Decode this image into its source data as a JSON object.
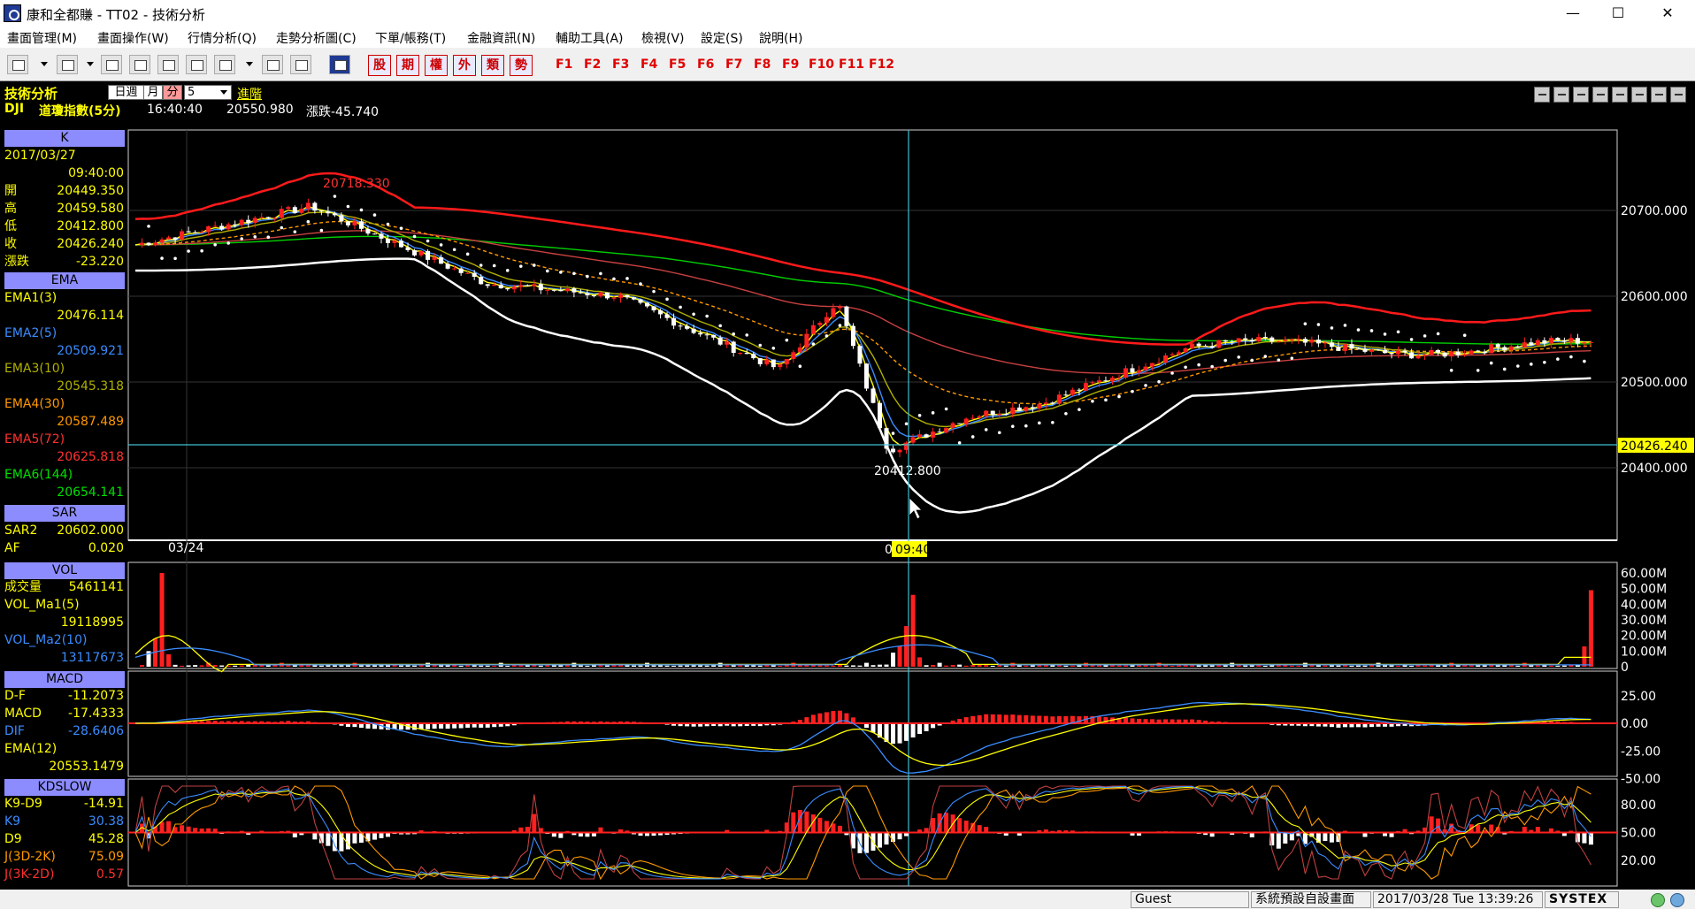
{
  "window": {
    "title": "康和全都賺 - TT02 - 技術分析",
    "minimize": "—",
    "maximize": "☐",
    "close": "✕"
  },
  "menu": [
    "畫面管理(M)",
    "畫面操作(W)",
    "行情分析(Q)",
    "走勢分析圖(C)",
    "下單/帳務(T)",
    "金融資訊(N)",
    "輔助工具(A)",
    "檢視(V)",
    "設定(S)",
    "說明(H)"
  ],
  "toolbar": {
    "quote_buttons": [
      "股",
      "期",
      "權",
      "外",
      "類",
      "勢"
    ],
    "function_keys": [
      "F1",
      "F2",
      "F3",
      "F4",
      "F5",
      "F6",
      "F7",
      "F8",
      "F9",
      "F10",
      "F11",
      "F12"
    ]
  },
  "header": {
    "title": "技術分析",
    "periods": [
      "日",
      "週",
      "月",
      "分"
    ],
    "period_value": "5",
    "advanced": "進階",
    "symbol": "DJI",
    "symbol_name": "道瓊指數(5分)",
    "time": "16:40:40",
    "price": "20550.980",
    "change": "漲跌-45.740"
  },
  "k_panel": {
    "head": "K",
    "date": "2017/03/27",
    "time": "09:40:00",
    "rows": [
      {
        "k": "開",
        "v": "20449.350"
      },
      {
        "k": "高",
        "v": "20459.580"
      },
      {
        "k": "低",
        "v": "20412.800"
      },
      {
        "k": "收",
        "v": "20426.240"
      },
      {
        "k": "漲跌",
        "v": "-23.220"
      }
    ]
  },
  "ema_panel": {
    "head": "EMA",
    "items": [
      {
        "name": "EMA1(3)",
        "value": "20476.114",
        "color": "#ffff00"
      },
      {
        "name": "EMA2(5)",
        "value": "20509.921",
        "color": "#3a8cff"
      },
      {
        "name": "EMA3(10)",
        "value": "20545.318",
        "color": "#b0b000"
      },
      {
        "name": "EMA4(30)",
        "value": "20587.489",
        "color": "#ff9900"
      },
      {
        "name": "EMA5(72)",
        "value": "20625.818",
        "color": "#ff3030"
      },
      {
        "name": "EMA6(144)",
        "value": "20654.141",
        "color": "#00e000"
      }
    ]
  },
  "sar_panel": {
    "head": "SAR",
    "rows": [
      {
        "k": "SAR2",
        "v": "20602.000"
      },
      {
        "k": "AF",
        "v": "0.020"
      }
    ]
  },
  "vol_panel": {
    "head": "VOL",
    "rows": [
      {
        "k": "成交量",
        "v": "5461141",
        "kc": "#ffff00"
      },
      {
        "k": "VOL_Ma1(5)",
        "v": "19118995",
        "kc": "#ffff00"
      },
      {
        "k": "VOL_Ma2(10)",
        "v": "13117673",
        "kc": "#3a8cff"
      }
    ]
  },
  "macd_panel": {
    "head": "MACD",
    "rows": [
      {
        "k": "D-F",
        "v": "-11.2073",
        "kc": "#ffff00"
      },
      {
        "k": "MACD",
        "v": "-17.4333",
        "kc": "#ffff00"
      },
      {
        "k": "DIF",
        "v": "-28.6406",
        "kc": "#3a8cff"
      },
      {
        "k": "EMA(12)",
        "v": "20553.1479",
        "kc": "#ffff00"
      }
    ]
  },
  "kd_panel": {
    "head": "KDSLOW",
    "rows": [
      {
        "k": "K9-D9",
        "v": "-14.91",
        "kc": "#ffff00"
      },
      {
        "k": "K9",
        "v": "30.38",
        "kc": "#3a8cff"
      },
      {
        "k": "D9",
        "v": "45.28",
        "kc": "#ffff00"
      },
      {
        "k": "J(3D-2K)",
        "v": "75.09",
        "kc": "#ff9900"
      },
      {
        "k": "J(3K-2D)",
        "v": "0.57",
        "kc": "#ff3030"
      }
    ]
  },
  "chart_data": {
    "type": "candlestick",
    "main_axis": [
      "20700.000",
      "20600.000",
      "20500.000",
      "20400.000"
    ],
    "last_price_tag": "20426.240",
    "high_label": "20718.330",
    "low_label": "20412.800",
    "x_date_label": "03/24",
    "cursor_time_label": "09:40",
    "cursor_prefix": "0",
    "vol_axis": [
      "60.00M",
      "50.00M",
      "40.00M",
      "30.00M",
      "20.00M",
      "10.00M",
      "0"
    ],
    "macd_axis": [
      "25.00",
      "0.00",
      "-25.00",
      "-50.00"
    ],
    "kd_axis": [
      "80.00",
      "50.00",
      "20.00"
    ]
  },
  "status": {
    "user": "Guest",
    "layout": "系統預設自設畫面",
    "datetime": "2017/03/28 Tue 13:39:26",
    "brand": "SYSTEX"
  }
}
